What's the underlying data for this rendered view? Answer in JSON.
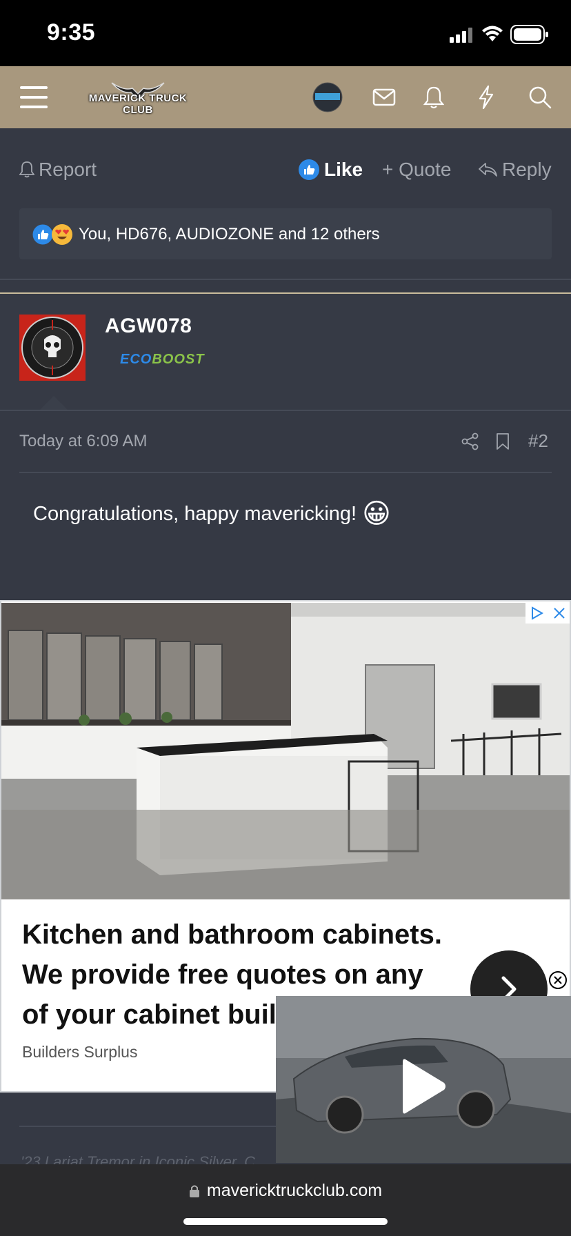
{
  "status_bar": {
    "time": "9:35"
  },
  "nav": {
    "site_name": "MAVERICK TRUCK CLUB",
    "icons": [
      "menu-icon",
      "avatar",
      "mail-icon",
      "bell-icon",
      "lightning-icon",
      "search-icon"
    ]
  },
  "previous_post": {
    "actions": {
      "report": "Report",
      "like": "Like",
      "quote": "+ Quote",
      "reply": "Reply"
    },
    "reactions_text": "You, HD676, AUDIOZONE and 12 others"
  },
  "post": {
    "username": "AGW078",
    "badge_eco": "ECO",
    "badge_boost": "BOOST",
    "timestamp": "Today at 6:09 AM",
    "post_number": "#2",
    "body": "Congratulations, happy mavericking!",
    "emoji": "😀"
  },
  "ad": {
    "headline": "Kitchen and bathroom cabinets. We provide free quotes on any of your cabinet buil",
    "advertiser": "Builders Surplus"
  },
  "next_post_preview": "'23 Lariat Tremor in Iconic Silver, C...",
  "browser": {
    "url": "mavericktruckclub.com"
  },
  "colors": {
    "nav_bg": "#a8987e",
    "content_bg": "#353944",
    "accent_blue": "#2d8ae8",
    "eco_green": "#8bc34a"
  }
}
